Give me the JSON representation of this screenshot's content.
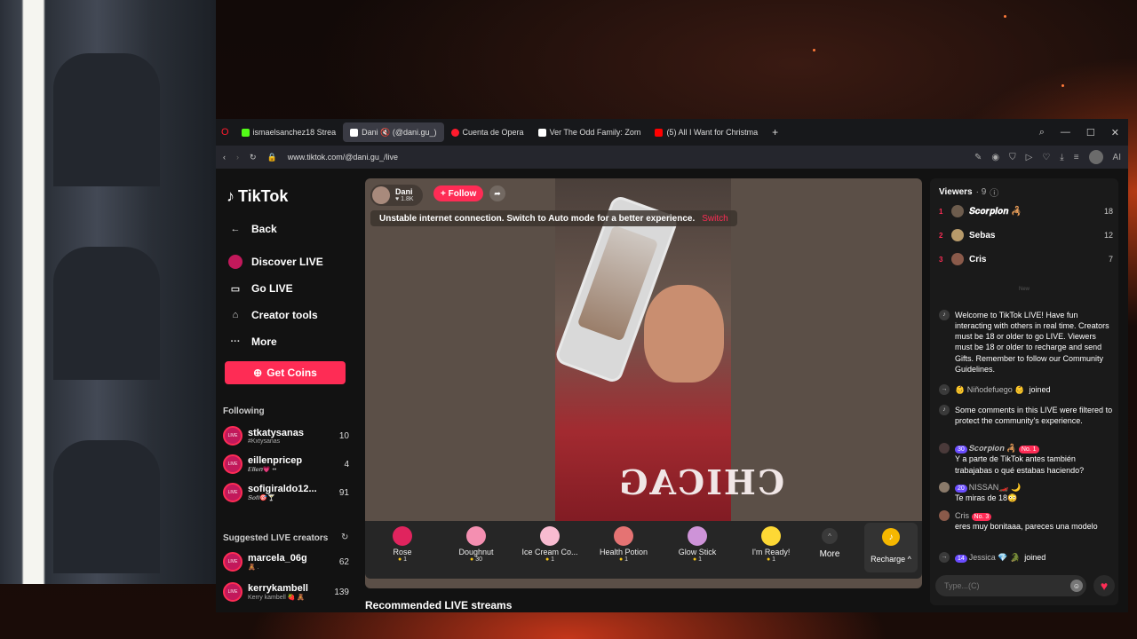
{
  "tabs": [
    {
      "label": "ismaelsanchez18 Strea",
      "color": "#53fc18",
      "icon": "kick-icon"
    },
    {
      "label": "Dani 🔇 (@dani.gu_)",
      "color": "#ffffff",
      "icon": "tiktok-icon",
      "active": true
    },
    {
      "label": "Cuenta de Opera",
      "color": "#ff1b2d",
      "icon": "opera-icon"
    },
    {
      "label": "Ver The Odd Family: Zom",
      "color": "#ffffff",
      "icon": "p-icon"
    },
    {
      "label": "(5) All I Want for Christma",
      "color": "#ff0000",
      "icon": "youtube-icon"
    }
  ],
  "url": "www.tiktok.com/@dani.gu_/live",
  "ai_label": "AI",
  "sidebar": {
    "logo": "TikTok",
    "nav": [
      {
        "label": "Back",
        "icon": "back-arrow-icon"
      },
      {
        "label": "Discover LIVE",
        "icon": "live-avatar-icon"
      },
      {
        "label": "Go LIVE",
        "icon": "video-camera-icon"
      },
      {
        "label": "Creator tools",
        "icon": "house-icon"
      },
      {
        "label": "More",
        "icon": "ellipsis-icon"
      }
    ],
    "get_coins": "Get Coins",
    "following_title": "Following",
    "following": [
      {
        "name": "stkatysanas",
        "sub": "#Kxtysanas",
        "count": "10"
      },
      {
        "name": "eillenpricep",
        "sub": "𝑬𝒍𝒍𝒆𝒏💗 ••",
        "count": "4"
      },
      {
        "name": "sofigiraldo12...",
        "sub": "𝑺𝒐𝒇𝒊🎯🍸",
        "count": "91"
      }
    ],
    "suggested_title": "Suggested LIVE creators",
    "suggested": [
      {
        "name": "marcela_06g",
        "sub": "🧸 .",
        "count": "62"
      },
      {
        "name": "kerrykambell",
        "sub": "Kerry kambell 🍓 🧸",
        "count": "139"
      }
    ]
  },
  "stream": {
    "host_name": "Dani",
    "host_likes": "♥ 1.8K",
    "follow_label": "+ Follow",
    "notice": "Unstable internet connection. Switch to Auto mode for a better experience.",
    "notice_action": "Switch",
    "shirt_text": "CHICAG"
  },
  "gifts": [
    {
      "name": "Rose",
      "price": "1",
      "color": "#e0245e"
    },
    {
      "name": "Doughnut",
      "price": "30",
      "color": "#f48fb1"
    },
    {
      "name": "Ice Cream Co...",
      "price": "1",
      "color": "#f8bbd0"
    },
    {
      "name": "Health Potion",
      "price": "1",
      "color": "#e57373"
    },
    {
      "name": "Glow Stick",
      "price": "1",
      "color": "#ce93d8"
    },
    {
      "name": "I'm Ready!",
      "price": "1",
      "color": "#fdd835"
    }
  ],
  "more_label": "More",
  "recharge_label": "Recharge ^",
  "recommended": "Recommended LIVE streams",
  "chat": {
    "title": "Viewers",
    "count": "· 9",
    "viewers": [
      {
        "rank": "1",
        "name": "𝑺𝒄𝒐𝒓𝒑𝒊𝒐𝒏 🦂",
        "score": "18"
      },
      {
        "rank": "2",
        "name": "Sebas",
        "score": "12"
      },
      {
        "rank": "3",
        "name": "Cris",
        "score": "7"
      }
    ],
    "new_label": "New",
    "messages": [
      {
        "who": "",
        "text": "Welcome to TikTok LIVE! Have fun interacting with others in real time. Creators must be 18 or older to go LIVE. Viewers must be 18 or older to recharge and send Gifts. Remember to follow our Community Guidelines."
      },
      {
        "who": "👶 Niñodefuego 👶",
        "text": "joined"
      },
      {
        "who": "",
        "text": "Some comments in this LIVE were filtered to protect the community's experience."
      },
      {
        "who": "𝑺𝒄𝒐𝒓𝒑𝒊𝒐𝒏 🦂",
        "badge": "30",
        "badge2": "No. 1",
        "text": "Y a parte de TikTok antes también trabajabas o qué estabas haciendo?"
      },
      {
        "who": "NISSAN🏎️ 🌙",
        "badge": "20",
        "text": "Te miras de 18😳"
      },
      {
        "who": "Cris",
        "badge2": "No. 3",
        "text": "eres muy bonitaaa, pareces una modelo"
      },
      {
        "who": "Jessica 💎 🐊",
        "badge": "14",
        "text": "joined"
      }
    ],
    "input_placeholder": "Type...(C)"
  }
}
